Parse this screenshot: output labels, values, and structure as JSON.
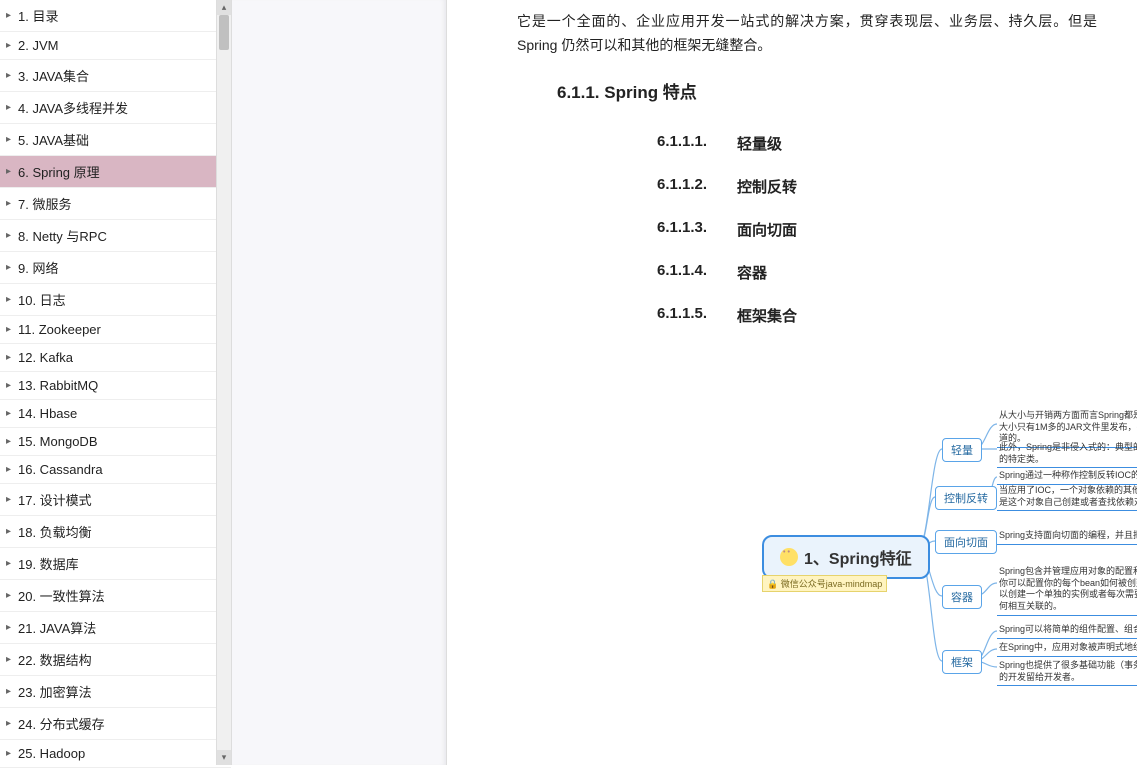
{
  "toc": [
    "1. 目录",
    "2. JVM",
    "3. JAVA集合",
    "4. JAVA多线程并发",
    "5. JAVA基础",
    "6. Spring 原理",
    "7.  微服务",
    "8. Netty 与RPC",
    "9. 网络",
    "10. 日志",
    "11. Zookeeper",
    "12. Kafka",
    "13. RabbitMQ",
    "14. Hbase",
    "15. MongoDB",
    "16. Cassandra",
    "17. 设计模式",
    "18. 负载均衡",
    "19. 数据库",
    "20. 一致性算法",
    "21. JAVA算法",
    "22. 数据结构",
    "23. 加密算法",
    "24. 分布式缓存",
    "25. Hadoop"
  ],
  "toc_active_index": 5,
  "intro": "它是一个全面的、企业应用开发一站式的解决方案，贯穿表现层、业务层、持久层。但是 Spring 仍然可以和其他的框架无缝整合。",
  "heading_611": "6.1.1.  Spring 特点",
  "subsections": [
    {
      "num": "6.1.1.1.",
      "title": "轻量级"
    },
    {
      "num": "6.1.1.2.",
      "title": "控制反转"
    },
    {
      "num": "6.1.1.3.",
      "title": "面向切面"
    },
    {
      "num": "6.1.1.4.",
      "title": "容器"
    },
    {
      "num": "6.1.1.5.",
      "title": "框架集合"
    }
  ],
  "mindmap": {
    "root": "1、Spring特征",
    "tag": "🔒 微信公众号java-mindmap",
    "nodes": {
      "n1": "轻量",
      "n2": "控制反转",
      "n3": "面向切面",
      "n4": "容器",
      "n5": "框架"
    },
    "texts": {
      "t1a": "从大小与开销两方面而言Spring都是轻量的。完整的Spring框架可以在一个大小只有1M多的JAR文件里发布，并且Spring所需的处理开销也是微不足道的。",
      "t1b": "此外，Spring是非侵入式的：典型的，Spring应用中的对象不依赖于Spring的特定类。",
      "t2a": "Spring通过一种称作控制反转IOC的技术促进了低耦合。",
      "t2b": "当应用了IOC，一个对象依赖的其他对象会通过被动的方式传递进来，而不是这个对象自己创建或者查找依赖对象。",
      "t3": "Spring支持面向切面的编程，并且把应用业务逻辑和系统服务分开",
      "t4": "Spring包含并管理应用对象的配置和生命周期，在这个意义上它是一种容器，你可以配置你的每个bean如何被创建------基于一个可配置原型，你的bean可以创建一个单独的实例或者每次需要时都生成一个新的实例------以及它们是如何相互关联的。",
      "t5a": "Spring可以将简单的组件配置、组合成为复杂的应用。",
      "t5b": "在Spring中，应用对象被声明式地组合，典型的是在一个XML文件里。",
      "t5c": "Spring也提供了很多基础功能（事务管理、持久化框架集成等），将应用逻辑的开发留给开发者。"
    }
  }
}
